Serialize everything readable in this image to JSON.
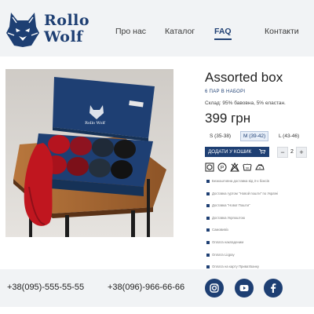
{
  "brand": {
    "line1": "Rollo",
    "line2": "Wolf"
  },
  "nav": [
    {
      "label": "Про нас",
      "active": false
    },
    {
      "label": "Каталог",
      "active": false
    },
    {
      "label": "FAQ",
      "active": true
    },
    {
      "label": "Контакти",
      "active": false
    }
  ],
  "product": {
    "title": "Assorted box",
    "subtitle": "6 ПАР В НАБОРІ",
    "composition": "Склад: 95% бавовна, 5% еластан.",
    "price": "399 грн",
    "sizes": [
      {
        "label": "S (35-38)",
        "selected": false
      },
      {
        "label": "M (39-42)",
        "selected": true
      },
      {
        "label": "L (43-46)",
        "selected": false
      }
    ],
    "buy_label": "ДОДАТИ У КОШИК",
    "quantity": "2",
    "qty_minus": "−",
    "qty_plus": "+",
    "box_brand": "Rollo Wolf",
    "care_icons": [
      "wash-icon",
      "dry-clean-icon",
      "no-bleach-icon",
      "hand-wash-icon",
      "iron-icon"
    ],
    "info": [
      "Безкоштовна доставка від 3-х боксів",
      "Доставка гуртом \"Новой пошти\" по Україні",
      "Доставка \"Нової Пошти\"",
      "Доставка Укрпоштою",
      "Самовивіз",
      "Оплата накладеним",
      "Оплата Liqpay",
      "Оплата на карту ПриватБанку"
    ]
  },
  "footer": {
    "phone1": "+38(095)-555-55-55",
    "phone2": "+38(096)-966-66-66",
    "social": [
      "instagram-icon",
      "youtube-icon",
      "facebook-icon"
    ]
  },
  "colors": {
    "brand": "#1e3f73",
    "header_bg": "#f1f3f5",
    "footer_bg": "#f1f3f5",
    "sock_red": "#b5141f"
  }
}
